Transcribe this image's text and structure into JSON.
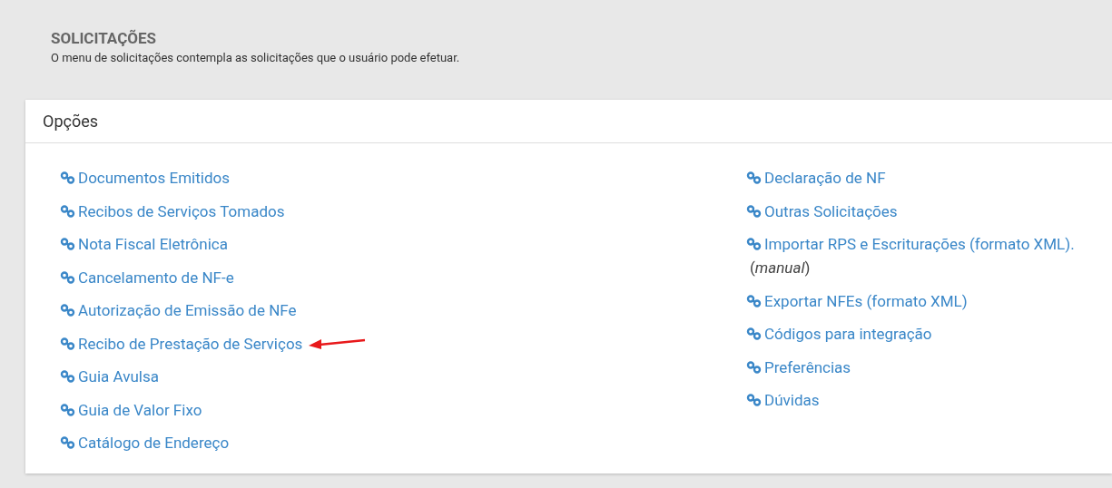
{
  "header": {
    "title": "SOLICITAÇÕES",
    "description": "O menu de solicitações contempla as solicitações que o usuário pode efetuar."
  },
  "panel": {
    "title": "Opções",
    "columns": [
      [
        {
          "label": "Documentos Emitidos",
          "arrow": false
        },
        {
          "label": "Recibos de Serviços Tomados",
          "arrow": false
        },
        {
          "label": "Nota Fiscal Eletrônica",
          "arrow": false
        },
        {
          "label": "Cancelamento de NF-e",
          "arrow": false
        },
        {
          "label": "Autorização de Emissão de NFe",
          "arrow": false
        },
        {
          "label": "Recibo de Prestação de Serviços",
          "arrow": true
        },
        {
          "label": "Guia Avulsa",
          "arrow": false
        },
        {
          "label": "Guia de Valor Fixo",
          "arrow": false
        },
        {
          "label": "Catálogo de Endereço",
          "arrow": false
        }
      ],
      [
        {
          "label": "Declaração de NF",
          "arrow": false
        },
        {
          "label": "Outras Solicitações",
          "arrow": false
        },
        {
          "label": "Importar RPS e Escriturações (formato XML).",
          "note": "(*manual*)",
          "arrow": false
        },
        {
          "label": "Exportar NFEs (formato XML)",
          "arrow": false
        },
        {
          "label": "Códigos para integração",
          "arrow": false
        },
        {
          "label": "Preferências",
          "arrow": false
        },
        {
          "label": "Dúvidas",
          "arrow": false
        }
      ]
    ]
  }
}
